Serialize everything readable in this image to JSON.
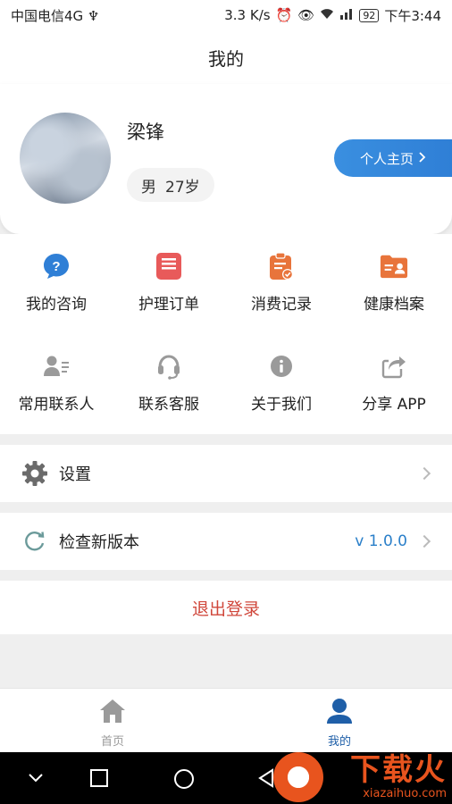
{
  "status_bar": {
    "carrier": "中国电信4G ♆",
    "speed": "3.3 K/s",
    "battery": "92",
    "time": "下午3:44"
  },
  "header": {
    "title": "我的"
  },
  "profile": {
    "name": "梁锋",
    "gender": "男",
    "age": "27岁",
    "homepage_label": "个人主页"
  },
  "grid": {
    "items": [
      {
        "label": "我的咨询",
        "icon": "question-chat-icon"
      },
      {
        "label": "护理订单",
        "icon": "nursing-order-icon"
      },
      {
        "label": "消费记录",
        "icon": "consumption-record-icon"
      },
      {
        "label": "健康档案",
        "icon": "health-file-icon"
      },
      {
        "label": "常用联系人",
        "icon": "contact-person-icon"
      },
      {
        "label": "联系客服",
        "icon": "headset-icon"
      },
      {
        "label": "关于我们",
        "icon": "info-icon"
      },
      {
        "label": "分享 APP",
        "icon": "share-icon"
      }
    ],
    "nursing_icon_text": "护理"
  },
  "settings": {
    "label": "设置"
  },
  "update": {
    "label": "检查新版本",
    "version": "v 1.0.0"
  },
  "logout": {
    "label": "退出登录"
  },
  "tabbar": {
    "home_label": "首页",
    "mine_label": "我的"
  },
  "watermark": {
    "text": "下载火",
    "sub": "xiazaihuo.com"
  },
  "colors": {
    "accent_blue": "#2f7fd6",
    "logout_red": "#d0473b",
    "icon_orange": "#e8743b",
    "icon_red": "#e85a5a",
    "icon_gray": "#9a9a9a"
  }
}
